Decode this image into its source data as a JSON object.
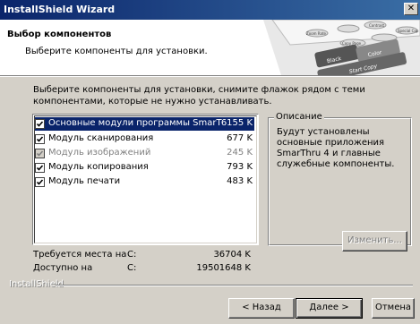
{
  "window": {
    "title": "InstallShield Wizard"
  },
  "header": {
    "title": "Выбор компонентов",
    "subtitle": "Выберите компоненты для установки."
  },
  "instructions": "Выберите компоненты для установки, снимите флажок рядом с теми компонентами, которые не нужно устанавливать.",
  "components": [
    {
      "label": "Основные модули программы SmarT",
      "size": "6155 K",
      "checked": true,
      "selected": true,
      "enabled": true
    },
    {
      "label": "Модуль сканирования",
      "size": "677 K",
      "checked": true,
      "selected": false,
      "enabled": true
    },
    {
      "label": "Модуль изображений",
      "size": "245 K",
      "checked": true,
      "selected": false,
      "enabled": false
    },
    {
      "label": "Модуль копирования",
      "size": "793 K",
      "checked": true,
      "selected": false,
      "enabled": true
    },
    {
      "label": "Модуль печати",
      "size": "483 K",
      "checked": true,
      "selected": false,
      "enabled": true
    }
  ],
  "description": {
    "title": "Описание",
    "text": "Будут установлены основные приложения SmarThru 4 и главные служебные компоненты."
  },
  "change_button": "Изменить...",
  "space": {
    "required_label": "Требуется места на",
    "required_drive": "C:",
    "required_value": "36704 K",
    "available_label": "Доступно на",
    "available_drive": "C:",
    "available_value": "19501648 K"
  },
  "brand": "InstallShield",
  "buttons": {
    "back": "< Назад",
    "next": "Далее >",
    "cancel": "Отмена"
  },
  "header_art_labels": [
    "Black",
    "Color",
    "Start Copy",
    "Copy Page",
    "Zoom Rate",
    "Special Cop",
    "Contrast"
  ]
}
